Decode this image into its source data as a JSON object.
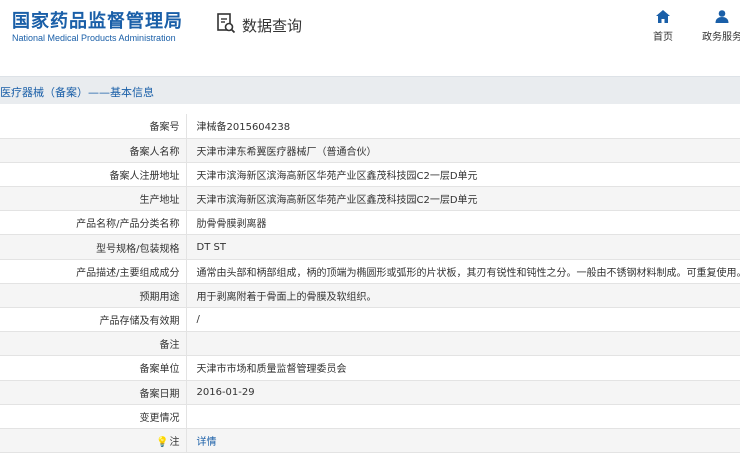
{
  "header": {
    "logo_cn": "国家药品监督管理局",
    "logo_en": "National Medical Products Administration",
    "query_label": "数据查询",
    "nav": [
      {
        "label": "首页",
        "icon": "home-icon"
      },
      {
        "label": "政务服务",
        "icon": "user-icon"
      }
    ]
  },
  "title": "医疗器械（备案）——基本信息",
  "rows": [
    {
      "label": "备案号",
      "value": "津械备2015604238"
    },
    {
      "label": "备案人名称",
      "value": "天津市津东希翼医疗器械厂（普通合伙）"
    },
    {
      "label": "备案人注册地址",
      "value": "天津市滨海新区滨海高新区华苑产业区鑫茂科技园C2一层D单元"
    },
    {
      "label": "生产地址",
      "value": "天津市滨海新区滨海高新区华苑产业区鑫茂科技园C2一层D单元"
    },
    {
      "label": "产品名称/产品分类名称",
      "value": "肋骨骨膜剥离器"
    },
    {
      "label": "型号规格/包装规格",
      "value": "DT ST"
    },
    {
      "label": "产品描述/主要组成成分",
      "value": "通常由头部和柄部组成，柄的顶端为椭圆形或弧形的片状板，其刃有锐性和钝性之分。一般由不锈钢材料制成。可重复使用。"
    },
    {
      "label": "预期用途",
      "value": "用于剥离附着于骨面上的骨膜及软组织。"
    },
    {
      "label": "产品存储及有效期",
      "value": "/"
    },
    {
      "label": "备注",
      "value": ""
    },
    {
      "label": "备案单位",
      "value": "天津市市场和质量监督管理委员会"
    },
    {
      "label": "备案日期",
      "value": "2016-01-29"
    },
    {
      "label": "变更情况",
      "value": ""
    },
    {
      "label": "注",
      "value": "详情"
    }
  ],
  "colors": {
    "brand": "#1a5fa8",
    "title_bar": "#e9ecef",
    "row_alt": "#f5f5f5"
  }
}
